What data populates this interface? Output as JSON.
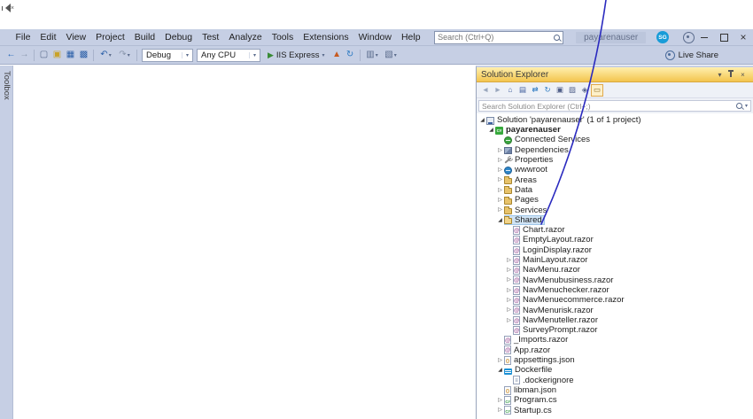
{
  "system": {
    "mute_glyph": "×"
  },
  "titlebar": {
    "menus": [
      "File",
      "Edit",
      "View",
      "Project",
      "Build",
      "Debug",
      "Test",
      "Analyze",
      "Tools",
      "Extensions",
      "Window",
      "Help"
    ],
    "search_placeholder": "Search (Ctrl+Q)",
    "window_title": "payarenauser",
    "avatar": "SG",
    "window_controls": {
      "close": "×"
    }
  },
  "main_toolbar": {
    "left_items": [
      {
        "name": "nav-back-icon",
        "glyph": "←",
        "color": "#1C62B7"
      },
      {
        "name": "nav-forward-icon",
        "glyph": "→",
        "color": "#8A97AD"
      },
      {
        "sep": true,
        "name": "separator"
      },
      {
        "name": "new-file-icon",
        "glyph": "▢",
        "color": "#5A6B8C"
      },
      {
        "name": "open-file-icon",
        "glyph": "▣",
        "color": "#C9A227"
      },
      {
        "name": "save-icon",
        "glyph": "▦",
        "color": "#2B5FA8"
      },
      {
        "name": "save-all-icon",
        "glyph": "▩",
        "color": "#2B5FA8"
      },
      {
        "sep": true,
        "name": "separator"
      },
      {
        "name": "undo-icon",
        "glyph": "↶",
        "color": "#2B5FA8",
        "caret": true
      },
      {
        "name": "redo-icon",
        "glyph": "↷",
        "color": "#8A97AD",
        "caret": true
      },
      {
        "sep": true,
        "name": "separator"
      }
    ],
    "debug_config": "Debug",
    "platform": "Any CPU",
    "run_label": "IIS Express",
    "mid_items": [
      {
        "name": "hot-reload-icon",
        "glyph": "▲",
        "color": "#C75A20"
      },
      {
        "name": "refresh-icon",
        "glyph": "↻",
        "color": "#2B79C2"
      },
      {
        "sep": true,
        "name": "separator"
      },
      {
        "name": "preview-icon",
        "glyph": "▥",
        "color": "#5A6B8C",
        "caret": true
      },
      {
        "name": "more-tools-icon",
        "glyph": "▧",
        "color": "#5A6B8C",
        "caret": true
      }
    ],
    "live_share_label": "Live Share"
  },
  "left_rail": {
    "toolbox_label": "Toolbox"
  },
  "solution_explorer": {
    "title": "Solution Explorer",
    "header_controls": {
      "position": "▾",
      "close": "×"
    },
    "toolbar_icons": [
      {
        "name": "back-icon",
        "glyph": "◄",
        "color": "#9AA7BD"
      },
      {
        "name": "forward-icon",
        "glyph": "►",
        "color": "#9AA7BD"
      },
      {
        "name": "home-icon",
        "glyph": "⌂",
        "color": "#3E5C9C"
      },
      {
        "name": "switch-views-icon",
        "glyph": "▤",
        "color": "#3E5C9C"
      },
      {
        "name": "sync-with-active-document-icon",
        "glyph": "⇄",
        "color": "#2B79C2"
      },
      {
        "name": "refresh-icon",
        "glyph": "↻",
        "color": "#2B79C2"
      },
      {
        "name": "collapse-all-icon",
        "glyph": "▣",
        "color": "#51608A"
      },
      {
        "name": "show-all-files-icon",
        "glyph": "▨",
        "color": "#51608A"
      },
      {
        "name": "properties-icon",
        "glyph": "◈",
        "color": "#51608A"
      },
      {
        "name": "preview-selected-items-icon",
        "glyph": "▭",
        "color": "#8A6A1F",
        "active": true
      }
    ],
    "search_placeholder": "Search Solution Explorer (Ctrl+;)",
    "tree": [
      {
        "label": "Solution 'payarenauser' (1 of 1 project)",
        "level": 0,
        "arrow": "expanded",
        "icon": "solution-icon"
      },
      {
        "label": "payarenauser",
        "level": 1,
        "arrow": "expanded",
        "icon": "project-icon",
        "bold": true
      },
      {
        "label": "Connected Services",
        "level": 2,
        "arrow": "none",
        "icon": "connected-services-icon"
      },
      {
        "label": "Dependencies",
        "level": 2,
        "arrow": "collapsed",
        "icon": "dependencies-icon"
      },
      {
        "label": "Properties",
        "level": 2,
        "arrow": "collapsed",
        "icon": "properties-icon"
      },
      {
        "label": "wwwroot",
        "level": 2,
        "arrow": "collapsed",
        "icon": "wwwroot-icon"
      },
      {
        "label": "Areas",
        "level": 2,
        "arrow": "collapsed",
        "icon": "folder-icon"
      },
      {
        "label": "Data",
        "level": 2,
        "arrow": "collapsed",
        "icon": "folder-icon"
      },
      {
        "label": "Pages",
        "level": 2,
        "arrow": "collapsed",
        "icon": "folder-icon"
      },
      {
        "label": "Services",
        "level": 2,
        "arrow": "collapsed",
        "icon": "folder-icon"
      },
      {
        "label": "Shared",
        "level": 2,
        "arrow": "expanded",
        "icon": "folder-open-icon",
        "selected": true
      },
      {
        "label": "Chart.razor",
        "level": 3,
        "arrow": "none",
        "icon": "razor-file-icon"
      },
      {
        "label": "EmptyLayout.razor",
        "level": 3,
        "arrow": "none",
        "icon": "razor-file-icon"
      },
      {
        "label": "LoginDisplay.razor",
        "level": 3,
        "arrow": "none",
        "icon": "razor-file-icon"
      },
      {
        "label": "MainLayout.razor",
        "level": 3,
        "arrow": "collapsed",
        "icon": "razor-file-icon"
      },
      {
        "label": "NavMenu.razor",
        "level": 3,
        "arrow": "collapsed",
        "icon": "razor-file-icon"
      },
      {
        "label": "NavMenubusiness.razor",
        "level": 3,
        "arrow": "collapsed",
        "icon": "razor-file-icon"
      },
      {
        "label": "NavMenuchecker.razor",
        "level": 3,
        "arrow": "collapsed",
        "icon": "razor-file-icon"
      },
      {
        "label": "NavMenuecommerce.razor",
        "level": 3,
        "arrow": "collapsed",
        "icon": "razor-file-icon"
      },
      {
        "label": "NavMenurisk.razor",
        "level": 3,
        "arrow": "collapsed",
        "icon": "razor-file-icon"
      },
      {
        "label": "NavMenuteller.razor",
        "level": 3,
        "arrow": "collapsed",
        "icon": "razor-file-icon"
      },
      {
        "label": "SurveyPrompt.razor",
        "level": 3,
        "arrow": "none",
        "icon": "razor-file-icon"
      },
      {
        "label": "_Imports.razor",
        "level": 2,
        "arrow": "none",
        "icon": "razor-file-icon"
      },
      {
        "label": "App.razor",
        "level": 2,
        "arrow": "none",
        "icon": "razor-file-icon"
      },
      {
        "label": "appsettings.json",
        "level": 2,
        "arrow": "collapsed",
        "icon": "json-file-icon"
      },
      {
        "label": "Dockerfile",
        "level": 2,
        "arrow": "expanded",
        "icon": "docker-icon"
      },
      {
        "label": ".dockerignore",
        "level": 3,
        "arrow": "none",
        "icon": "dockerignore-icon"
      },
      {
        "label": "libman.json",
        "level": 2,
        "arrow": "none",
        "icon": "json-file-icon"
      },
      {
        "label": "Program.cs",
        "level": 2,
        "arrow": "collapsed",
        "icon": "cs-file-icon"
      },
      {
        "label": "Startup.cs",
        "level": 2,
        "arrow": "collapsed",
        "icon": "cs-file-icon"
      }
    ]
  },
  "annotation": {
    "color": "#2A2ABF"
  }
}
